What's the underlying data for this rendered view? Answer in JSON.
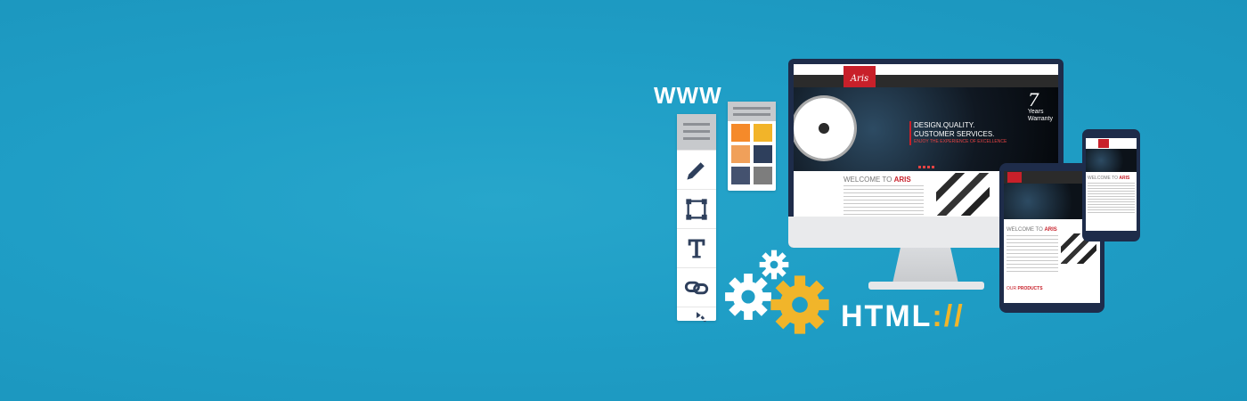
{
  "banner": {
    "www_label": "WWW",
    "html_label": "HTML",
    "html_slashes": "://"
  },
  "tools": {
    "icons": [
      "pencil-icon",
      "bounding-box-icon",
      "text-icon",
      "link-icon",
      "rotate-icon"
    ]
  },
  "palette": {
    "colors": [
      "#f58a2a",
      "#f2b429",
      "#f0a05a",
      "#2e3f5c",
      "#44526f",
      "#7d7d7d"
    ]
  },
  "website": {
    "logo_text": "Aris",
    "years_number": "7",
    "years_line1": "Years",
    "years_line2": "Warranty",
    "headline_line1": "DESIGN.QUALITY.",
    "headline_line2": "CUSTOMER SERVICES.",
    "headline_tag": "ENJOY THE EXPERIENCE OF EXCELLENCE",
    "welcome_prefix": "WELCOME TO ",
    "welcome_brand": "ARIS",
    "products_prefix": "OUR ",
    "products_label": "PRODUCTS"
  },
  "colors": {
    "background": "#1f9ec6",
    "device_frame": "#1e2c4a",
    "accent_red": "#c8202a",
    "gear_yellow": "#f1b52a"
  }
}
